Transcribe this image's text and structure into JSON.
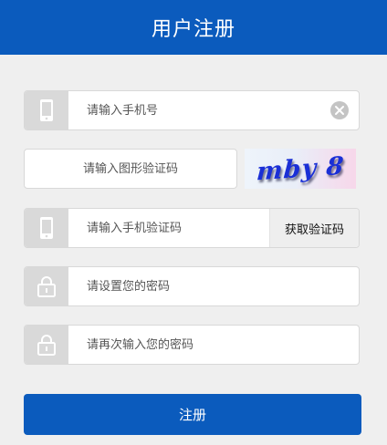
{
  "header": {
    "title": "用户注册"
  },
  "form": {
    "phone": {
      "placeholder": "请输入手机号",
      "icon": "phone-icon",
      "clear_icon": "clear-icon"
    },
    "captcha": {
      "placeholder": "请输入图形验证码",
      "image_text": "mby 8"
    },
    "sms_code": {
      "placeholder": "请输入手机验证码",
      "icon": "phone-icon",
      "button_label": "获取验证码"
    },
    "password": {
      "placeholder": "请设置您的密码",
      "icon": "lock-icon"
    },
    "password_confirm": {
      "placeholder": "请再次输入您的密码",
      "icon": "lock-icon"
    },
    "submit_label": "注册"
  },
  "colors": {
    "primary": "#0b5bbd",
    "background": "#efefef",
    "icon_cell": "#d9d9d9"
  }
}
